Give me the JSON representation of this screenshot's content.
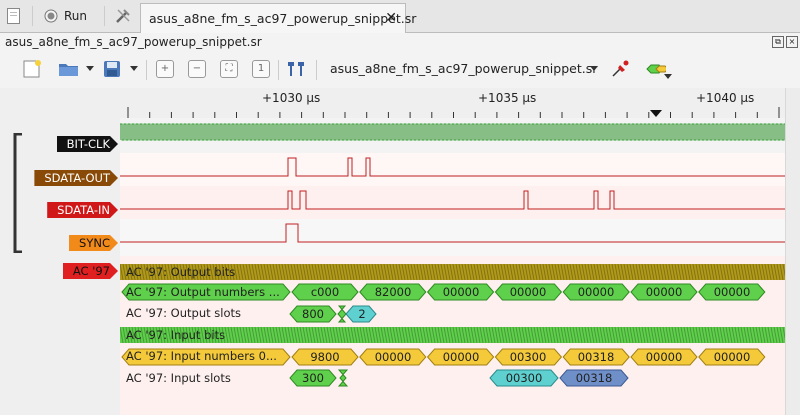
{
  "topbar": {
    "run_label": "Run",
    "tab_title": "asus_a8ne_fm_s_ac97_powerup_snippet.sr",
    "close_glyph": "✕"
  },
  "view_title": "asus_a8ne_fm_s_ac97_powerup_snippet.sr",
  "toolbar": {
    "session_name": "asus_a8ne_fm_s_ac97_powerup_snippet.sr"
  },
  "ruler": {
    "labels": [
      "+1030 µs",
      "+1035 µs",
      "+1040 µs"
    ]
  },
  "colors": {
    "accent_green": "#5fd04b",
    "yellow": "#f4c93a",
    "olive": "#b19a1a",
    "teal": "#5fd0d0",
    "steel_blue": "#6f8fc8",
    "trace_red": "#c02020",
    "trace_green": "#2a9d2a"
  },
  "signals": [
    {
      "name": "BIT-CLK",
      "color": "#111111",
      "text_color": "#ffffff"
    },
    {
      "name": "SDATA-OUT",
      "color": "#8a4a07",
      "text_color": "#ffffff"
    },
    {
      "name": "SDATA-IN",
      "color": "#d01818",
      "text_color": "#ffffff"
    },
    {
      "name": "SYNC",
      "color": "#f28a1a",
      "text_color": "#111111"
    }
  ],
  "decoder": {
    "tag": "AC '97",
    "rows": [
      {
        "label": "AC '97: Output bits"
      },
      {
        "label": "AC '97: Output numbers ...",
        "values": [
          "c000",
          "82000",
          "00000",
          "00000",
          "00000",
          "00000",
          "00000"
        ]
      },
      {
        "label": "AC '97: Output slots",
        "values": [
          "800",
          "2"
        ]
      },
      {
        "label": "AC '97: Input bits"
      },
      {
        "label": "AC '97: Input numbers 0...",
        "values": [
          "9800",
          "00000",
          "00000",
          "00300",
          "00318",
          "00000",
          "00000"
        ]
      },
      {
        "label": "AC '97: Input slots",
        "values": [
          "300",
          "00300",
          "00318"
        ]
      }
    ]
  }
}
